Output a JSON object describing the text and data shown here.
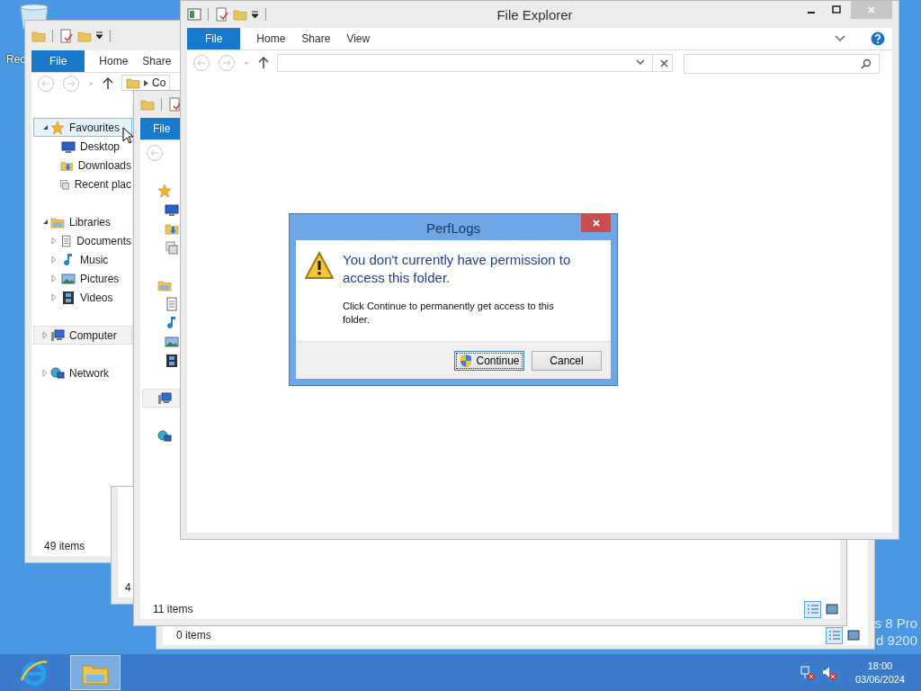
{
  "desktop": {
    "recycle_bin_label": "Rec",
    "os_text": [
      "s 8 Pro",
      "d 9200"
    ]
  },
  "explorer_back": {
    "tabs": [
      {
        "label": "File",
        "selected": true
      },
      {
        "label": "Home",
        "selected": false
      },
      {
        "label": "Share",
        "selected": false
      }
    ],
    "address": "Co",
    "tree": [
      {
        "label": "Favourites",
        "kind": "favourites",
        "expanded": true,
        "hovered": true,
        "selected": false,
        "children": [
          {
            "label": "Desktop",
            "kind": "desktop"
          },
          {
            "label": "Downloads",
            "kind": "downloads"
          },
          {
            "label": "Recent plac",
            "kind": "recent"
          }
        ]
      },
      {
        "label": "Libraries",
        "kind": "libraries",
        "expanded": true,
        "hovered": false,
        "selected": false,
        "children": [
          {
            "label": "Documents",
            "kind": "documents",
            "expanded": false
          },
          {
            "label": "Music",
            "kind": "music",
            "expanded": false
          },
          {
            "label": "Pictures",
            "kind": "pictures",
            "expanded": false
          },
          {
            "label": "Videos",
            "kind": "videos",
            "expanded": false
          }
        ]
      },
      {
        "label": "Computer",
        "kind": "computer",
        "expanded": false,
        "hovered": false,
        "selected": true
      },
      {
        "label": "Network",
        "kind": "network",
        "expanded": false,
        "hovered": false,
        "selected": false
      }
    ],
    "status": "49 items"
  },
  "explorer_lower": {
    "status": "4"
  },
  "explorer_bottom": {
    "status": "0 items",
    "views": [
      {
        "kind": "details",
        "selected": true
      },
      {
        "kind": "large_icons",
        "selected": false
      }
    ]
  },
  "explorer_middle": {
    "tabs": [
      {
        "label": "File",
        "selected": true
      }
    ],
    "tree": [
      {
        "kind": "favourites",
        "selected": false,
        "children": [
          {
            "kind": "desktop"
          },
          {
            "kind": "downloads"
          },
          {
            "kind": "recent"
          }
        ]
      },
      {
        "kind": "libraries",
        "selected": false,
        "children": [
          {
            "kind": "documents"
          },
          {
            "kind": "music"
          },
          {
            "kind": "pictures"
          },
          {
            "kind": "videos"
          }
        ]
      },
      {
        "kind": "computer",
        "selected": true
      },
      {
        "kind": "network",
        "selected": false
      }
    ],
    "status": "11 items",
    "views": [
      {
        "kind": "details",
        "selected": true
      },
      {
        "kind": "large_icons",
        "selected": false
      }
    ]
  },
  "explorer_main": {
    "title": "File Explorer",
    "tabs": [
      {
        "label": "File",
        "selected": true
      },
      {
        "label": "Home",
        "selected": false
      },
      {
        "label": "Share",
        "selected": false
      },
      {
        "label": "View",
        "selected": false
      }
    ]
  },
  "dialog": {
    "title": "PerfLogs",
    "heading": "You don't currently have permission to access this folder.",
    "message": "Click Continue to permanently get access to this folder.",
    "buttons": [
      {
        "label": "Continue",
        "kind": "shield",
        "default": true
      },
      {
        "label": "Cancel",
        "kind": "plain",
        "default": false
      }
    ]
  },
  "taskbar": {
    "apps": [
      {
        "kind": "browser",
        "active": false
      },
      {
        "kind": "explorer",
        "active": true
      }
    ],
    "time": "18:00",
    "date": "03/06/2024"
  }
}
